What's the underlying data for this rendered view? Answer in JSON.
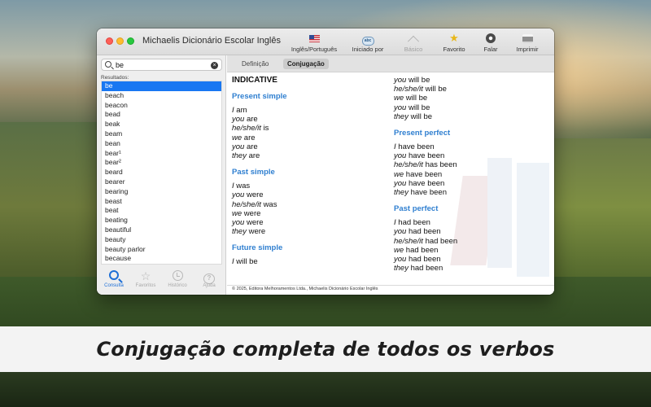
{
  "window": {
    "title": "Michaelis Dicionário Escolar Inglês"
  },
  "toolbar": {
    "items": [
      {
        "label": "Inglês/Português",
        "icon": "us-flag-icon"
      },
      {
        "label": "Iniciado por",
        "icon": "starts-with-icon"
      },
      {
        "label": "Básico",
        "icon": "basic-icon",
        "disabled": true
      },
      {
        "label": "Favorito",
        "icon": "star-icon"
      },
      {
        "label": "Falar",
        "icon": "speaker-icon"
      },
      {
        "label": "Imprimir",
        "icon": "printer-icon"
      }
    ],
    "badge_text": "abc"
  },
  "search": {
    "value": "be"
  },
  "results": {
    "label": "Resultados:",
    "items": [
      "be",
      "beach",
      "beacon",
      "bead",
      "beak",
      "beam",
      "bean",
      "bear¹",
      "bear²",
      "beard",
      "bearer",
      "bearing",
      "beast",
      "beat",
      "beating",
      "beautiful",
      "beauty",
      "beauty parlor",
      "because"
    ],
    "selected": "be"
  },
  "bottom_tabs": [
    {
      "label": "Consulta",
      "icon": "search-icon",
      "active": true
    },
    {
      "label": "Favoritos",
      "icon": "star-outline-icon"
    },
    {
      "label": "Histórico",
      "icon": "clock-icon"
    },
    {
      "label": "Ajuda",
      "icon": "help-icon"
    }
  ],
  "tabs": {
    "definition": "Definição",
    "conjugation": "Conjugação",
    "active": "Conjugação"
  },
  "conjugation": {
    "mood": "INDICATIVE",
    "present_simple": {
      "title": "Present simple",
      "lines": [
        [
          "I",
          "am"
        ],
        [
          "you",
          "are"
        ],
        [
          "he/she/it",
          "is"
        ],
        [
          "we",
          "are"
        ],
        [
          "you",
          "are"
        ],
        [
          "they",
          "are"
        ]
      ]
    },
    "past_simple": {
      "title": "Past simple",
      "lines": [
        [
          "I",
          "was"
        ],
        [
          "you",
          "were"
        ],
        [
          "he/she/it",
          "was"
        ],
        [
          "we",
          "were"
        ],
        [
          "you",
          "were"
        ],
        [
          "they",
          "were"
        ]
      ]
    },
    "future_simple": {
      "title": "Future simple",
      "lines_left": [
        [
          "I",
          "will be"
        ]
      ],
      "lines_right": [
        [
          "you",
          "will be"
        ],
        [
          "he/she/it",
          "will be"
        ],
        [
          "we",
          "will be"
        ],
        [
          "you",
          "will be"
        ],
        [
          "they",
          "will be"
        ]
      ]
    },
    "present_perfect": {
      "title": "Present perfect",
      "lines": [
        [
          "I",
          "have been"
        ],
        [
          "you",
          "have been"
        ],
        [
          "he/she/it",
          "has been"
        ],
        [
          "we",
          "have been"
        ],
        [
          "you",
          "have been"
        ],
        [
          "they",
          "have been"
        ]
      ]
    },
    "past_perfect": {
      "title": "Past perfect",
      "lines": [
        [
          "I",
          "had been"
        ],
        [
          "you",
          "had been"
        ],
        [
          "he/she/it",
          "had been"
        ],
        [
          "we",
          "had been"
        ],
        [
          "you",
          "had been"
        ],
        [
          "they",
          "had been"
        ]
      ]
    }
  },
  "footer": "© 2025, Editora Melhoramentos Ltda., Michaelis Dicionário Escolar Inglês",
  "caption": "Conjugação completa de todos os verbos"
}
